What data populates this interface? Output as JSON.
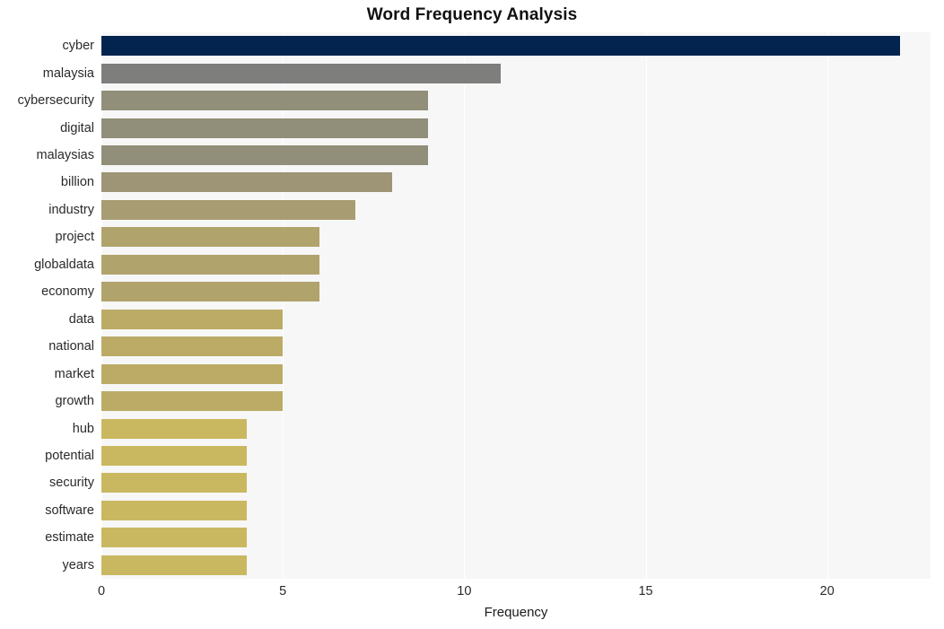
{
  "chart_data": {
    "type": "bar",
    "orientation": "horizontal",
    "title": "Word Frequency Analysis",
    "xlabel": "Frequency",
    "ylabel": "",
    "xlim": [
      0,
      22.85
    ],
    "xticks": [
      0,
      5,
      10,
      15,
      20
    ],
    "xtick_labels": [
      "0",
      "5",
      "10",
      "15",
      "20"
    ],
    "grid": true,
    "grid_axis": "x",
    "legend": false,
    "plot_background": "#f7f7f7",
    "figure_background": "#ffffff",
    "categories": [
      "cyber",
      "malaysia",
      "cybersecurity",
      "digital",
      "malaysias",
      "billion",
      "industry",
      "project",
      "globaldata",
      "economy",
      "data",
      "national",
      "market",
      "growth",
      "hub",
      "potential",
      "security",
      "software",
      "estimate",
      "years"
    ],
    "values": [
      22,
      11,
      9,
      9,
      9,
      8,
      7,
      6,
      6,
      6,
      5,
      5,
      5,
      5,
      4,
      4,
      4,
      4,
      4,
      4
    ],
    "bar_colors": [
      "#042450",
      "#7e7e7c",
      "#918e79",
      "#918e79",
      "#918e79",
      "#9d9575",
      "#a89c72",
      "#b0a36c",
      "#b0a36c",
      "#b0a36c",
      "#bbab66",
      "#bbab66",
      "#bbab66",
      "#bbab66",
      "#c9b860",
      "#c9b860",
      "#c9b860",
      "#c9b860",
      "#c9b860",
      "#c9b860"
    ]
  }
}
